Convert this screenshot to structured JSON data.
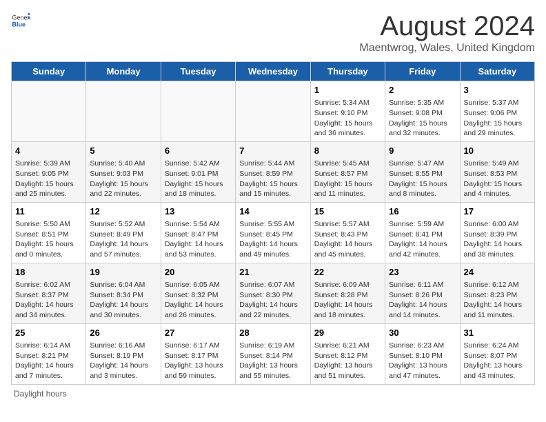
{
  "header": {
    "logo_general": "General",
    "logo_blue": "Blue",
    "title": "August 2024",
    "subtitle": "Maentwrog, Wales, United Kingdom"
  },
  "weekdays": [
    "Sunday",
    "Monday",
    "Tuesday",
    "Wednesday",
    "Thursday",
    "Friday",
    "Saturday"
  ],
  "weeks": [
    [
      {
        "day": "",
        "info": ""
      },
      {
        "day": "",
        "info": ""
      },
      {
        "day": "",
        "info": ""
      },
      {
        "day": "",
        "info": ""
      },
      {
        "day": "1",
        "info": "Sunrise: 5:34 AM\nSunset: 9:10 PM\nDaylight: 15 hours and 36 minutes."
      },
      {
        "day": "2",
        "info": "Sunrise: 5:35 AM\nSunset: 9:08 PM\nDaylight: 15 hours and 32 minutes."
      },
      {
        "day": "3",
        "info": "Sunrise: 5:37 AM\nSunset: 9:06 PM\nDaylight: 15 hours and 29 minutes."
      }
    ],
    [
      {
        "day": "4",
        "info": "Sunrise: 5:39 AM\nSunset: 9:05 PM\nDaylight: 15 hours and 25 minutes."
      },
      {
        "day": "5",
        "info": "Sunrise: 5:40 AM\nSunset: 9:03 PM\nDaylight: 15 hours and 22 minutes."
      },
      {
        "day": "6",
        "info": "Sunrise: 5:42 AM\nSunset: 9:01 PM\nDaylight: 15 hours and 18 minutes."
      },
      {
        "day": "7",
        "info": "Sunrise: 5:44 AM\nSunset: 8:59 PM\nDaylight: 15 hours and 15 minutes."
      },
      {
        "day": "8",
        "info": "Sunrise: 5:45 AM\nSunset: 8:57 PM\nDaylight: 15 hours and 11 minutes."
      },
      {
        "day": "9",
        "info": "Sunrise: 5:47 AM\nSunset: 8:55 PM\nDaylight: 15 hours and 8 minutes."
      },
      {
        "day": "10",
        "info": "Sunrise: 5:49 AM\nSunset: 8:53 PM\nDaylight: 15 hours and 4 minutes."
      }
    ],
    [
      {
        "day": "11",
        "info": "Sunrise: 5:50 AM\nSunset: 8:51 PM\nDaylight: 15 hours and 0 minutes."
      },
      {
        "day": "12",
        "info": "Sunrise: 5:52 AM\nSunset: 8:49 PM\nDaylight: 14 hours and 57 minutes."
      },
      {
        "day": "13",
        "info": "Sunrise: 5:54 AM\nSunset: 8:47 PM\nDaylight: 14 hours and 53 minutes."
      },
      {
        "day": "14",
        "info": "Sunrise: 5:55 AM\nSunset: 8:45 PM\nDaylight: 14 hours and 49 minutes."
      },
      {
        "day": "15",
        "info": "Sunrise: 5:57 AM\nSunset: 8:43 PM\nDaylight: 14 hours and 45 minutes."
      },
      {
        "day": "16",
        "info": "Sunrise: 5:59 AM\nSunset: 8:41 PM\nDaylight: 14 hours and 42 minutes."
      },
      {
        "day": "17",
        "info": "Sunrise: 6:00 AM\nSunset: 8:39 PM\nDaylight: 14 hours and 38 minutes."
      }
    ],
    [
      {
        "day": "18",
        "info": "Sunrise: 6:02 AM\nSunset: 8:37 PM\nDaylight: 14 hours and 34 minutes."
      },
      {
        "day": "19",
        "info": "Sunrise: 6:04 AM\nSunset: 8:34 PM\nDaylight: 14 hours and 30 minutes."
      },
      {
        "day": "20",
        "info": "Sunrise: 6:05 AM\nSunset: 8:32 PM\nDaylight: 14 hours and 26 minutes."
      },
      {
        "day": "21",
        "info": "Sunrise: 6:07 AM\nSunset: 8:30 PM\nDaylight: 14 hours and 22 minutes."
      },
      {
        "day": "22",
        "info": "Sunrise: 6:09 AM\nSunset: 8:28 PM\nDaylight: 14 hours and 18 minutes."
      },
      {
        "day": "23",
        "info": "Sunrise: 6:11 AM\nSunset: 8:26 PM\nDaylight: 14 hours and 14 minutes."
      },
      {
        "day": "24",
        "info": "Sunrise: 6:12 AM\nSunset: 8:23 PM\nDaylight: 14 hours and 11 minutes."
      }
    ],
    [
      {
        "day": "25",
        "info": "Sunrise: 6:14 AM\nSunset: 8:21 PM\nDaylight: 14 hours and 7 minutes."
      },
      {
        "day": "26",
        "info": "Sunrise: 6:16 AM\nSunset: 8:19 PM\nDaylight: 14 hours and 3 minutes."
      },
      {
        "day": "27",
        "info": "Sunrise: 6:17 AM\nSunset: 8:17 PM\nDaylight: 13 hours and 59 minutes."
      },
      {
        "day": "28",
        "info": "Sunrise: 6:19 AM\nSunset: 8:14 PM\nDaylight: 13 hours and 55 minutes."
      },
      {
        "day": "29",
        "info": "Sunrise: 6:21 AM\nSunset: 8:12 PM\nDaylight: 13 hours and 51 minutes."
      },
      {
        "day": "30",
        "info": "Sunrise: 6:23 AM\nSunset: 8:10 PM\nDaylight: 13 hours and 47 minutes."
      },
      {
        "day": "31",
        "info": "Sunrise: 6:24 AM\nSunset: 8:07 PM\nDaylight: 13 hours and 43 minutes."
      }
    ]
  ],
  "footer": {
    "note": "Daylight hours"
  }
}
